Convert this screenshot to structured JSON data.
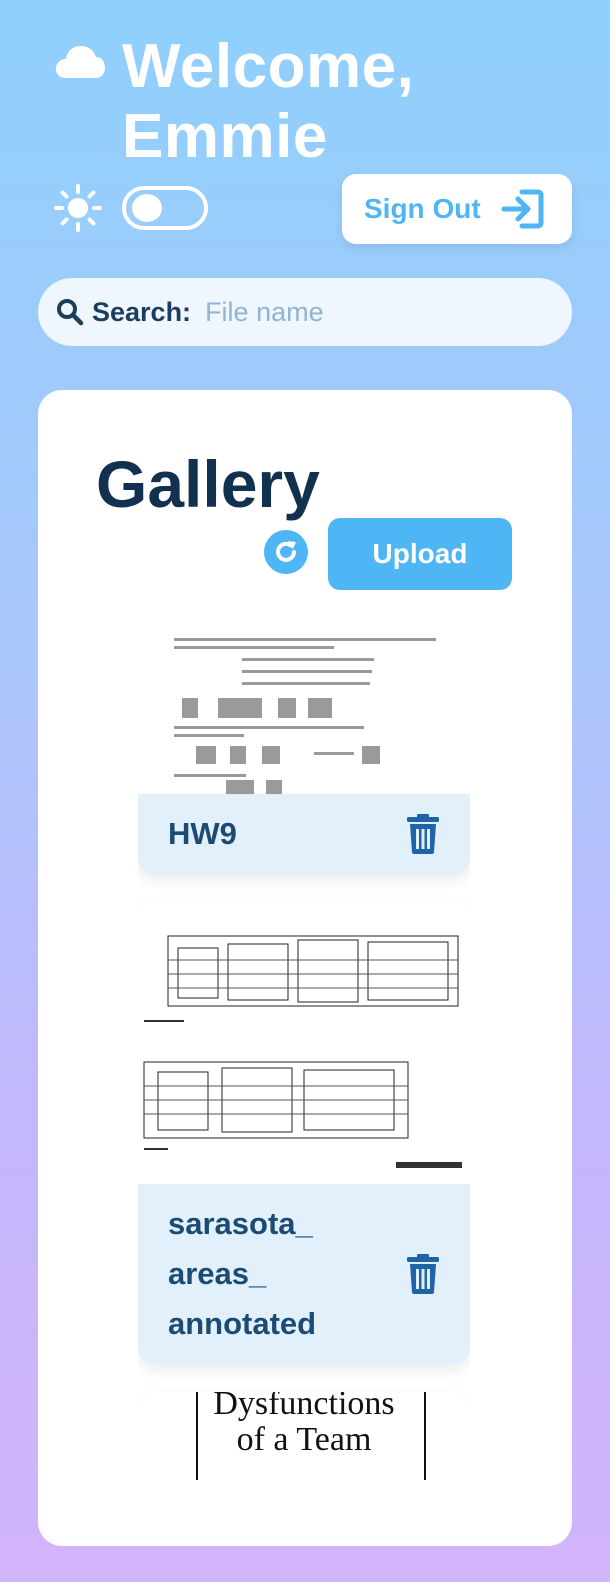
{
  "header": {
    "welcome_line1": "Welcome,",
    "welcome_line2": "Emmie",
    "signout_label": "Sign Out"
  },
  "search": {
    "label": "Search:",
    "placeholder": "File name",
    "value": ""
  },
  "gallery": {
    "title": "Gallery",
    "upload_label": "Upload",
    "items": [
      {
        "name": "HW9"
      },
      {
        "name_lines": [
          "sarasota_",
          "areas_",
          "annotated"
        ]
      },
      {
        "thumb_text_line1": "Dysfunctions",
        "thumb_text_line2": "of a Team"
      }
    ]
  },
  "theme": {
    "accent": "#4fb6f5",
    "title_color": "#12304f",
    "card_footer_bg": "#e2f0fb",
    "trash_color": "#1f64a6"
  },
  "icons": [
    "cloud-icon",
    "sun-icon",
    "theme-toggle",
    "sign-out-icon",
    "search-icon",
    "refresh-icon",
    "trash-icon"
  ]
}
